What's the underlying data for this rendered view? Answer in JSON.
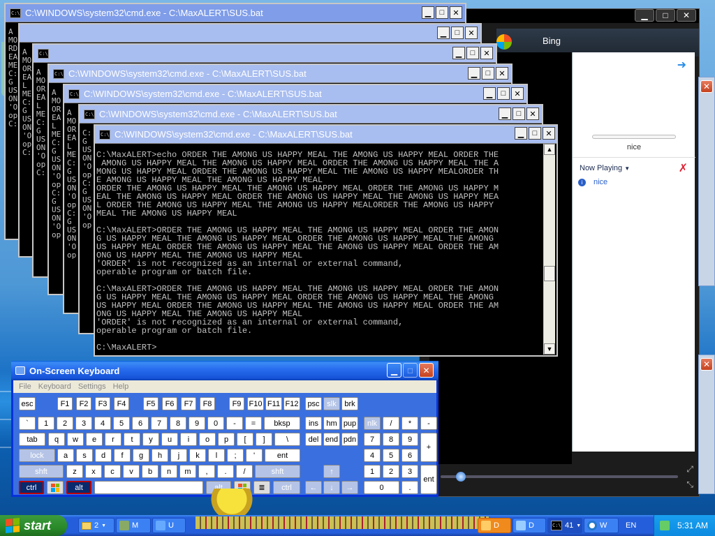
{
  "colors": {
    "xp_blue": "#245edb",
    "start_green": "#2a8a2a",
    "console_text": "#c0c0c0"
  },
  "stacked_windows": [
    {
      "title": "C:\\WINDOWS\\system32\\cmd.exe - C:\\MaxALERT\\SUS.bat",
      "frag": "A MO RD EA ME C: G US ON 'O op C:"
    },
    {
      "title": "",
      "frag": "A MO OR EA L ME C: G US ON 'O op C:"
    },
    {
      "title": "",
      "frag": "A MO OR EA L ME C: G US ON 'O op C:"
    },
    {
      "title": "C:\\WINDOWS\\system32\\cmd.exe - C:\\MaxALERT\\SUS.bat",
      "frag": "A MO OR EA L ME C: G US ON 'O op C: G US ON 'O op"
    },
    {
      "title": "C:\\WINDOWS\\system32\\cmd.exe - C:\\MaxALERT\\SUS.bat",
      "frag": "A MO OR EA L ME C: G US ON 'O op C: G US ON 'O op"
    },
    {
      "title": "C:\\WINDOWS\\system32\\cmd.exe - C:\\MaxALERT\\SUS.bat",
      "frag": "C: G US ON 'O op C: G US ON 'O op"
    }
  ],
  "main_cmd": {
    "title": "C:\\WINDOWS\\system32\\cmd.exe - C:\\MaxALERT\\SUS.bat",
    "console": "C:\\MaxALERT>echo ORDER THE AMONG US HAPPY MEAL THE AMONG US HAPPY MEAL ORDER THE\n AMONG US HAPPY MEAL THE AMONG US HAPPY MEAL ORDER THE AMONG US HAPPY MEAL THE A\nMONG US HAPPY MEAL ORDER THE AMONG US HAPPY MEAL THE AMONG US HAPPY MEALORDER TH\nE AMONG US HAPPY MEAL THE AMONG US HAPPY MEAL\nORDER THE AMONG US HAPPY MEAL THE AMONG US HAPPY MEAL ORDER THE AMONG US HAPPY M\nEAL THE AMONG US HAPPY MEAL ORDER THE AMONG US HAPPY MEAL THE AMONG US HAPPY MEA\nL ORDER THE AMONG US HAPPY MEAL THE AMONG US HAPPY MEALORDER THE AMONG US HAPPY\nMEAL THE AMONG US HAPPY MEAL\n\nC:\\MaxALERT>ORDER THE AMONG US HAPPY MEAL THE AMONG US HAPPY MEAL ORDER THE AMON\nG US HAPPY MEAL THE AMONG US HAPPY MEAL ORDER THE AMONG US HAPPY MEAL THE AMONG\nUS HAPPY MEAL ORDER THE AMONG US HAPPY MEAL THE AMONG US HAPPY MEAL ORDER THE AM\nONG US HAPPY MEAL THE AMONG US HAPPY MEAL\n'ORDER' is not recognized as an internal or external command,\noperable program or batch file.\n\nC:\\MaxALERT>ORDER THE AMONG US HAPPY MEAL THE AMONG US HAPPY MEAL ORDER THE AMON\nG US HAPPY MEAL THE AMONG US HAPPY MEAL ORDER THE AMONG US HAPPY MEAL THE AMONG\nUS HAPPY MEAL ORDER THE AMONG US HAPPY MEAL THE AMONG US HAPPY MEAL ORDER THE AM\nONG US HAPPY MEAL THE AMONG US HAPPY MEAL\n'ORDER' is not recognized as an internal or external command,\noperable program or batch file.\n\nC:\\MaxALERT>"
  },
  "media": {
    "bing_label": "Bing",
    "now_label": "nice",
    "now_playing": "Now Playing",
    "track": "nice"
  },
  "osk": {
    "title": "On-Screen Keyboard",
    "menu": [
      "File",
      "Keyboard",
      "Settings",
      "Help"
    ],
    "keys": {
      "esc": "esc",
      "f1": "F1",
      "f2": "F2",
      "f3": "F3",
      "f4": "F4",
      "f5": "F5",
      "f6": "F6",
      "f7": "F7",
      "f8": "F8",
      "f9": "F9",
      "f10": "F10",
      "f11": "F11",
      "f12": "F12",
      "psc": "psc",
      "slk": "slk",
      "brk": "brk",
      "grave": "`",
      "n1": "1",
      "n2": "2",
      "n3": "3",
      "n4": "4",
      "n5": "5",
      "n6": "6",
      "n7": "7",
      "n8": "8",
      "n9": "9",
      "n0": "0",
      "minus": "-",
      "equal": "=",
      "bksp": "bksp",
      "ins": "ins",
      "hm": "hm",
      "pup": "pup",
      "nlk": "nlk",
      "slash": "/",
      "star": "*",
      "npminus": "-",
      "tab": "tab",
      "q": "q",
      "w": "w",
      "e": "e",
      "r": "r",
      "t": "t",
      "y": "y",
      "u": "u",
      "i": "i",
      "o": "o",
      "p": "p",
      "lbr": "[",
      "rbr": "]",
      "bslash": "\\",
      "del": "del",
      "end": "end",
      "pdn": "pdn",
      "np7": "7",
      "np8": "8",
      "np9": "9",
      "plus": "+",
      "lock": "lock",
      "a": "a",
      "s": "s",
      "d": "d",
      "f": "f",
      "g": "g",
      "h": "h",
      "j": "j",
      "k": "k",
      "l": "l",
      "semi": ";",
      "quote": "'",
      "ent": "ent",
      "np4": "4",
      "np5": "5",
      "np6": "6",
      "shft": "shft",
      "z": "z",
      "x": "x",
      "c": "c",
      "v": "v",
      "b": "b",
      "n": "n",
      "m": "m",
      "comma": ",",
      "dot": ".",
      "fslash": "/",
      "rshft": "shft",
      "up": "↑",
      "np1": "1",
      "np2": "2",
      "np3": "3",
      "npent": "ent",
      "ctrl": "ctrl",
      "alt": "alt",
      "ralt": "alt",
      "rctrl": "ctrl",
      "left": "←",
      "down": "↓",
      "right": "→",
      "np0": "0",
      "npdot": "."
    }
  },
  "taskbar": {
    "start": "start",
    "items": [
      "2",
      "M",
      "U",
      "D",
      "D",
      "41",
      "W"
    ],
    "lang": "EN",
    "clock": "5:31 AM"
  }
}
